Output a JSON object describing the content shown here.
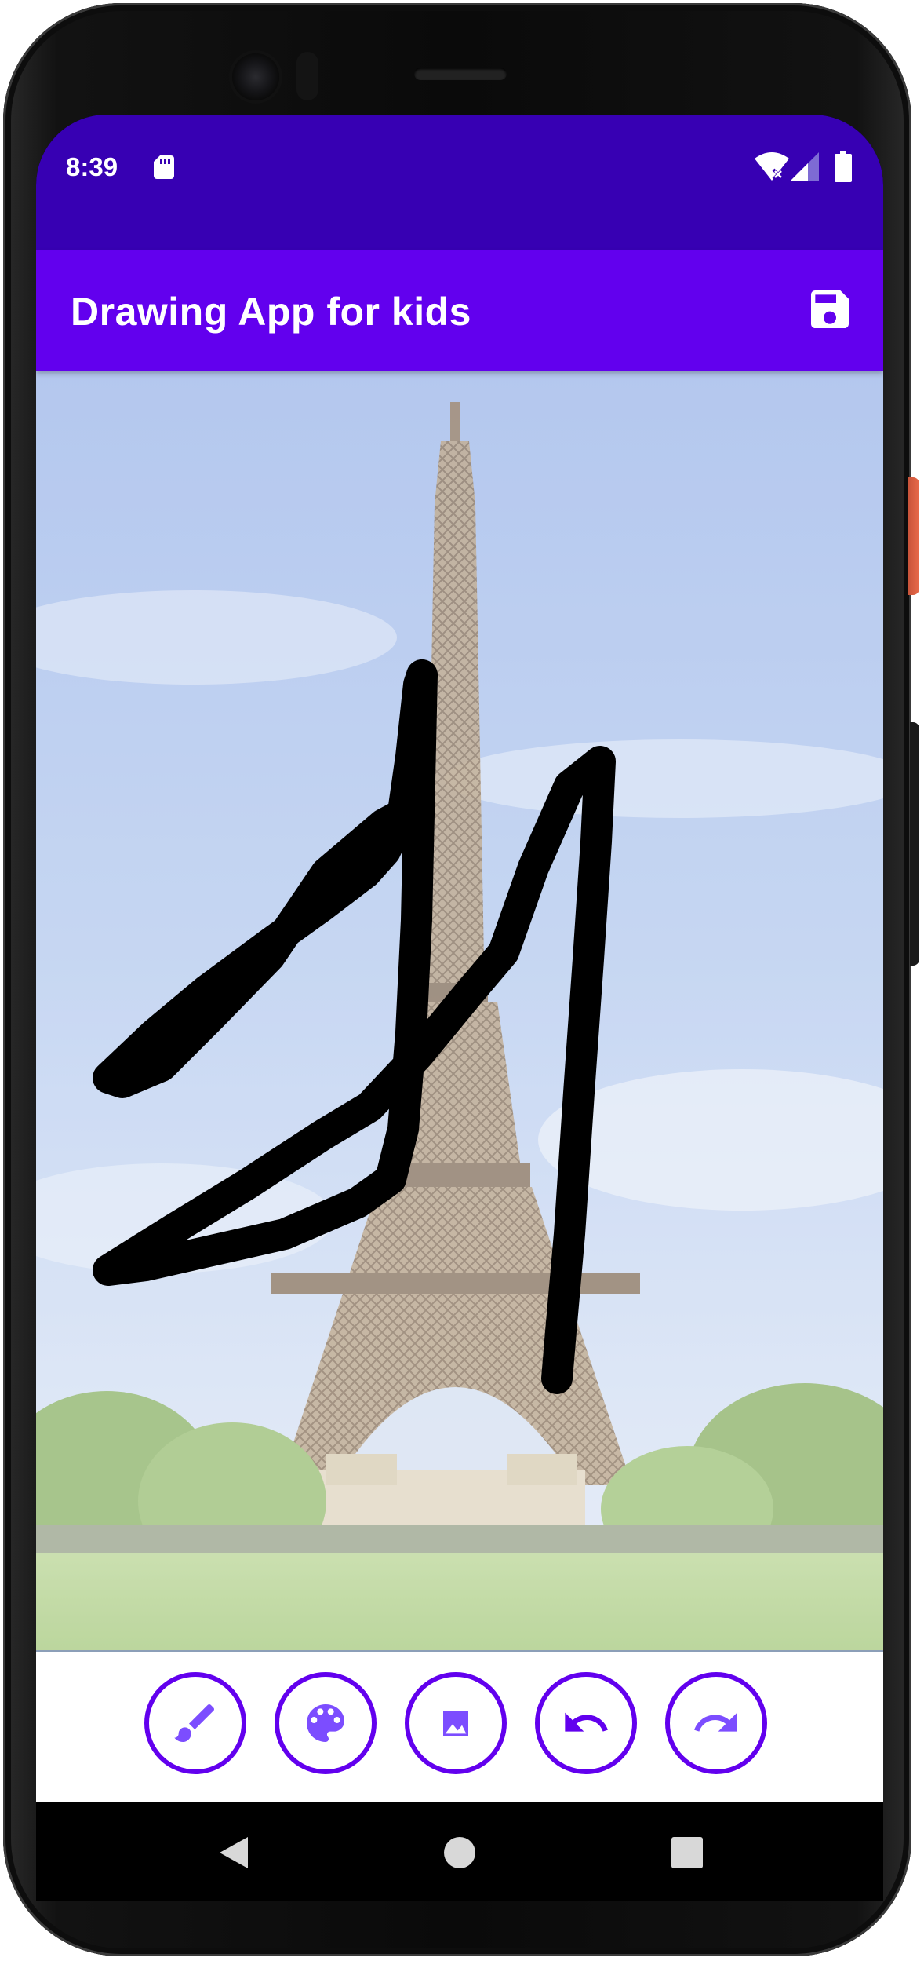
{
  "status_bar": {
    "time": "8:39",
    "icons": [
      "sd-card-icon",
      "wifi-icon",
      "signal-icon",
      "battery-icon"
    ]
  },
  "app_bar": {
    "title": "Drawing App for kids",
    "actions": [
      {
        "icon": "save-icon"
      }
    ]
  },
  "canvas": {
    "background_image": "eiffel-tower-photo",
    "brush_color": "#000000"
  },
  "toolbar": {
    "buttons": [
      {
        "icon": "brush-icon"
      },
      {
        "icon": "palette-icon"
      },
      {
        "icon": "image-icon"
      },
      {
        "icon": "undo-icon"
      },
      {
        "icon": "redo-icon"
      }
    ]
  },
  "nav_bar": {
    "buttons": [
      {
        "icon": "back-icon"
      },
      {
        "icon": "home-icon"
      },
      {
        "icon": "recents-icon"
      }
    ]
  },
  "colors": {
    "status_bar": "#3700b3",
    "app_bar": "#6200ee",
    "accent": "#6200ee"
  }
}
